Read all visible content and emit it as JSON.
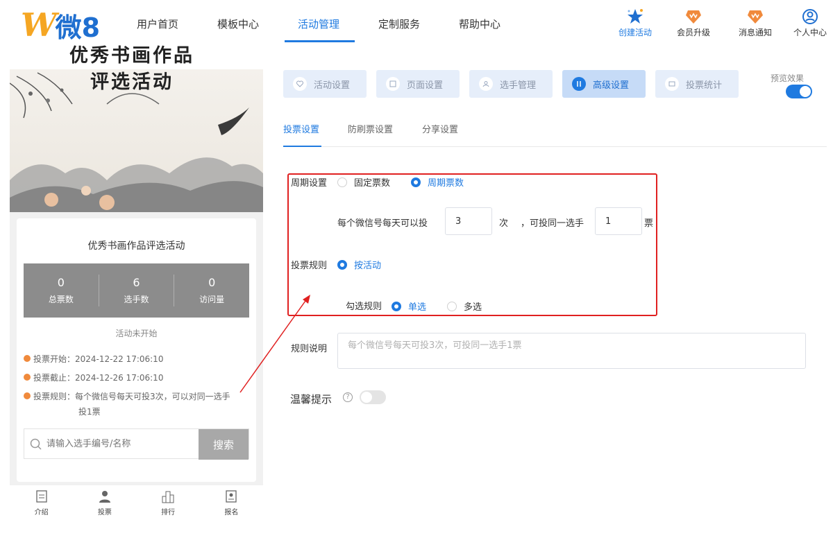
{
  "header": {
    "logo_letter": "W",
    "logo_text": "微8",
    "nav": [
      "用户首页",
      "模板中心",
      "活动管理",
      "定制服务",
      "帮助中心"
    ],
    "actions": [
      "创建活动",
      "会员升级",
      "消息通知",
      "个人中心"
    ]
  },
  "preview": {
    "banner_title_1": "优秀书画作品",
    "banner_title_2": "评选活动",
    "activity_name": "优秀书画作品评选活动",
    "stats": [
      {
        "value": "0",
        "label": "总票数"
      },
      {
        "value": "6",
        "label": "选手数"
      },
      {
        "value": "0",
        "label": "访问量"
      }
    ],
    "status": "活动未开始",
    "vote_start": "投票开始：2024-12-22 17:06:10",
    "vote_end": "投票截止：2024-12-26 17:06:10",
    "vote_rule_1": "投票规则：每个微信号每天可投3次，可以对同一选手",
    "vote_rule_2": "投1票",
    "search_placeholder": "请输入选手编号/名称",
    "search_button": "搜索",
    "tabbar": [
      "介绍",
      "投票",
      "排行",
      "报名"
    ]
  },
  "config": {
    "tabs": [
      "活动设置",
      "页面设置",
      "选手管理",
      "高级设置",
      "投票统计"
    ],
    "preview_label": "预览效果",
    "subtabs": [
      "投票设置",
      "防刷票设置",
      "分享设置"
    ],
    "period_label": "周期设置",
    "period_options": [
      "固定票数",
      "周期票数"
    ],
    "daily_prefix": "每个微信号每天可以投",
    "daily_count": "3",
    "daily_unit": "次",
    "same_prefix": "，可投同一选手",
    "same_count": "1",
    "same_unit": "票",
    "rule_label": "投票规则",
    "rule_option": "按活动",
    "check_label": "勾选规则",
    "check_options": [
      "单选",
      "多选"
    ],
    "desc_label": "规则说明",
    "desc_placeholder": "每个微信号每天可投3次，可投同一选手1票",
    "tips_label": "温馨提示",
    "help_glyph": "?"
  },
  "colors": {
    "accent": "#1f7ae0",
    "highlight": "#e02020"
  }
}
